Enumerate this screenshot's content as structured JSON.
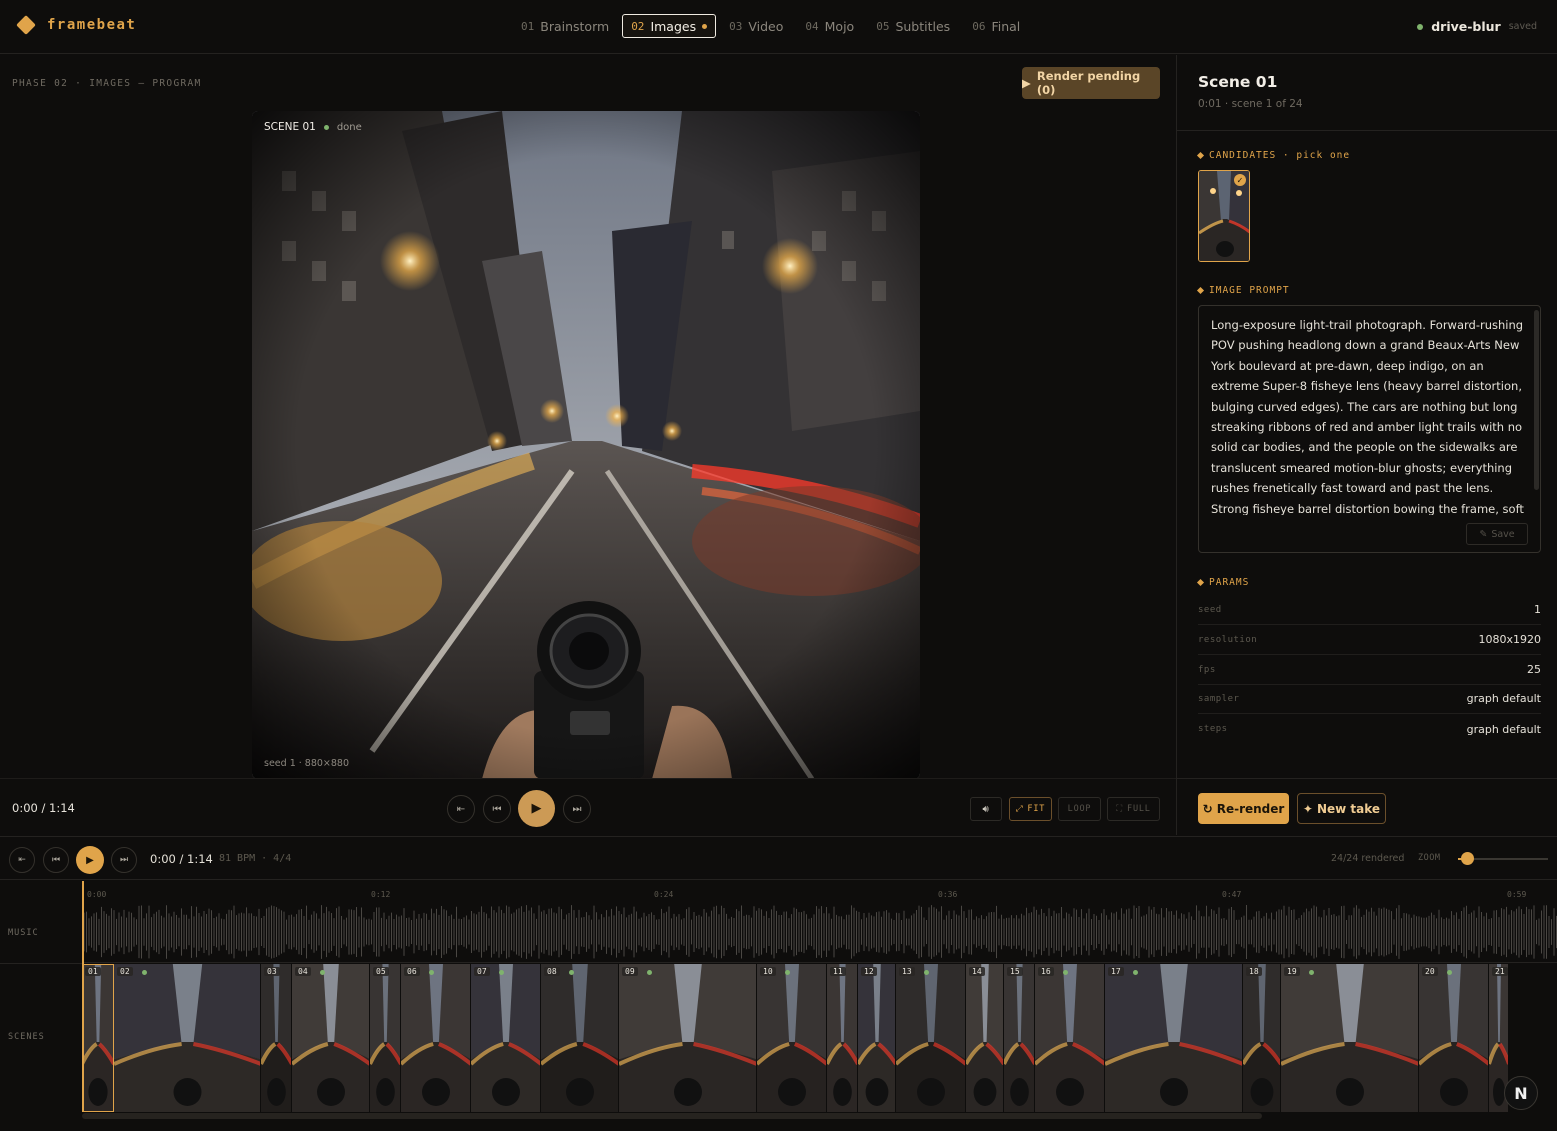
{
  "app": {
    "logo_text": "framebeat",
    "brand_color": "#e0a44a",
    "project_name": "drive-blur",
    "project_status": "saved"
  },
  "tabs": [
    {
      "num": "01",
      "label": "Brainstorm",
      "active": false
    },
    {
      "num": "02",
      "label": "Images",
      "active": true
    },
    {
      "num": "03",
      "label": "Video",
      "active": false
    },
    {
      "num": "04",
      "label": "Mojo",
      "active": false
    },
    {
      "num": "05",
      "label": "Subtitles",
      "active": false
    },
    {
      "num": "06",
      "label": "Final",
      "active": false
    }
  ],
  "stage": {
    "phase_label": "PHASE 02 · IMAGES — PROGRAM",
    "render_button": "Render pending (0)",
    "frame_scene": "SCENE 01",
    "frame_state": "done",
    "frame_seed": "seed 1 · 880×880"
  },
  "player": {
    "time": "0:00 / 1:14",
    "fit_label": "FIT",
    "loop_label": "LOOP",
    "full_label": "FULL"
  },
  "panel": {
    "scene_title": "Scene 01",
    "scene_sub": "0:01 · scene 1 of 24",
    "candidates_label": "CANDIDATES · pick one",
    "prompt_label": "IMAGE PROMPT",
    "prompt_text": "Long-exposure light-trail photograph. Forward-rushing POV pushing headlong down a grand Beaux-Arts New York boulevard at pre-dawn, deep indigo, on an extreme Super-8 fisheye lens (heavy barrel distortion, bulging curved edges). The cars are nothing but long streaking ribbons of red and amber light trails with no solid car bodies, and the people on the sidewalks are translucent smeared motion-blur ghosts; everything rushes frenetically fast toward and past the lens. Strong fisheye barrel distortion bowing the frame, soft",
    "save_label": "Save",
    "params_label": "PARAMS",
    "params": [
      {
        "key": "seed",
        "value": "1"
      },
      {
        "key": "resolution",
        "value": "1080x1920"
      },
      {
        "key": "fps",
        "value": "25"
      },
      {
        "key": "sampler",
        "value": "graph default"
      },
      {
        "key": "steps",
        "value": "graph default"
      }
    ],
    "rerender_label": "Re-render",
    "newtake_label": "New take"
  },
  "timeline": {
    "time": "0:00 / 1:14",
    "bpm": "81 BPM · 4/4",
    "rendered": "24/24 rendered",
    "zoom_label": "ZOOM",
    "zoom_level": 0.1,
    "music_label": "MUSIC",
    "scenes_label": "SCENES",
    "ticks": [
      "0:00",
      "0:12",
      "0:24",
      "0:36",
      "0:47",
      "0:59"
    ],
    "scenes": [
      {
        "n": "01",
        "selected": true
      },
      {
        "n": "02"
      },
      {
        "n": "03"
      },
      {
        "n": "04"
      },
      {
        "n": "05"
      },
      {
        "n": "06"
      },
      {
        "n": "07"
      },
      {
        "n": "08"
      },
      {
        "n": "09"
      },
      {
        "n": "10"
      },
      {
        "n": "11"
      },
      {
        "n": "12"
      },
      {
        "n": "13"
      },
      {
        "n": "14"
      },
      {
        "n": "15"
      },
      {
        "n": "16"
      },
      {
        "n": "17"
      },
      {
        "n": "18"
      },
      {
        "n": "19"
      },
      {
        "n": "20"
      },
      {
        "n": "21"
      }
    ]
  },
  "badge": "N"
}
